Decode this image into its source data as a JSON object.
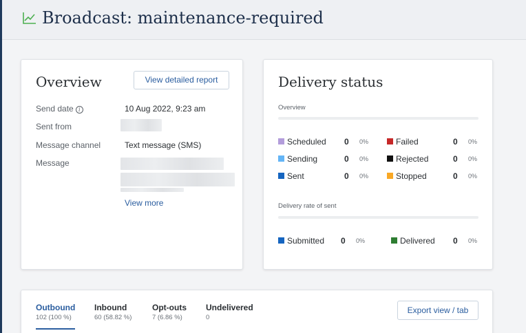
{
  "header": {
    "title": "Broadcast: maintenance-required",
    "icon": "line-chart-icon",
    "accent": "#4caf50"
  },
  "overview": {
    "title": "Overview",
    "report_button": "View detailed report",
    "fields": [
      {
        "label": "Send date",
        "value": "10 Aug 2022, 9:23 am",
        "info_icon": "info-icon"
      },
      {
        "label": "Sent from",
        "value": ""
      },
      {
        "label": "Message channel",
        "value": "Text message (SMS)"
      },
      {
        "label": "Message",
        "value": ""
      }
    ],
    "view_more": "View more"
  },
  "delivery": {
    "title": "Delivery status",
    "overview_label": "Overview",
    "stats": [
      {
        "label": "Scheduled",
        "count": "0",
        "pct": "0%",
        "color": "#b39ddb"
      },
      {
        "label": "Failed",
        "count": "0",
        "pct": "0%",
        "color": "#c62828"
      },
      {
        "label": "Sending",
        "count": "0",
        "pct": "0%",
        "color": "#64b5f6"
      },
      {
        "label": "Rejected",
        "count": "0",
        "pct": "0%",
        "color": "#111111"
      },
      {
        "label": "Sent",
        "count": "0",
        "pct": "0%",
        "color": "#1565c0"
      },
      {
        "label": "Stopped",
        "count": "0",
        "pct": "0%",
        "color": "#f9a825"
      }
    ],
    "rate_label": "Delivery rate of sent",
    "rate_stats": [
      {
        "label": "Submitted",
        "count": "0",
        "pct": "0%",
        "color": "#1565c0"
      },
      {
        "label": "Delivered",
        "count": "0",
        "pct": "0%",
        "color": "#2e7d32"
      }
    ]
  },
  "tabs": {
    "items": [
      {
        "label": "Outbound",
        "sub": "102 (100 %)",
        "active": true
      },
      {
        "label": "Inbound",
        "sub": "60 (58.82 %)"
      },
      {
        "label": "Opt-outs",
        "sub": "7 (6.86 %)"
      },
      {
        "label": "Undelivered",
        "sub": "0"
      }
    ],
    "export_button": "Export view / tab"
  }
}
